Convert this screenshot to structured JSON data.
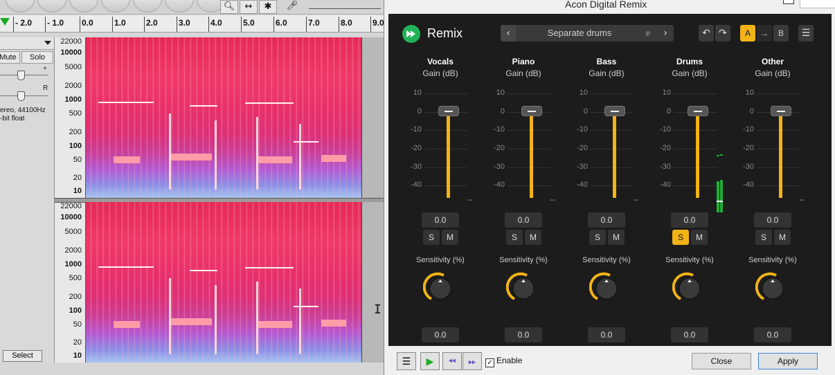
{
  "audacity": {
    "ruler_ticks": [
      "- 2.0",
      "- 1.0",
      "0.0",
      "1.0",
      "2.0",
      "3.0",
      "4.0",
      "5.0",
      "6.0",
      "7.0",
      "8.0",
      "9.0"
    ],
    "track": {
      "mute_label": "Mute",
      "solo_label": "Solo",
      "gain_plus": "+",
      "pan_right": "R",
      "info_line1": "ereo, 44100Hz",
      "info_line2": "-bit float"
    },
    "freq_labels": [
      "22000",
      "10000",
      "5000",
      "2000",
      "1000",
      "500",
      "200",
      "100",
      "50",
      "20",
      "10"
    ],
    "select_label": "Select"
  },
  "plugin": {
    "window_title": "Acon Digital Remix",
    "name": "Remix",
    "preset_name": "Separate drums",
    "ab": {
      "a": "A",
      "arrow": "→",
      "b": "B"
    },
    "scale_labels": [
      "10",
      "0",
      "-10",
      "-20",
      "-30",
      "-40"
    ],
    "meter_dash": "--",
    "gain_label": "Gain (dB)",
    "sensitivity_label": "Sensitivity (%)",
    "solo_label": "S",
    "mute_label": "M",
    "channels": [
      {
        "name": "Vocals",
        "gain": "0.0",
        "sensitivity": "0.0",
        "solo": false
      },
      {
        "name": "Piano",
        "gain": "0.0",
        "sensitivity": "0.0",
        "solo": false
      },
      {
        "name": "Bass",
        "gain": "0.0",
        "sensitivity": "0.0",
        "solo": false
      },
      {
        "name": "Drums",
        "gain": "0.0",
        "sensitivity": "0.0",
        "solo": true
      },
      {
        "name": "Other",
        "gain": "0.0",
        "sensitivity": "0.0",
        "solo": false
      }
    ],
    "enable_label": "Enable",
    "enable_checked": true,
    "close_label": "Close",
    "apply_label": "Apply",
    "colors": {
      "accent": "#f2b316",
      "logo": "#21b35a",
      "meter": "#1fae3b",
      "panel": "#1c1c1c"
    }
  }
}
